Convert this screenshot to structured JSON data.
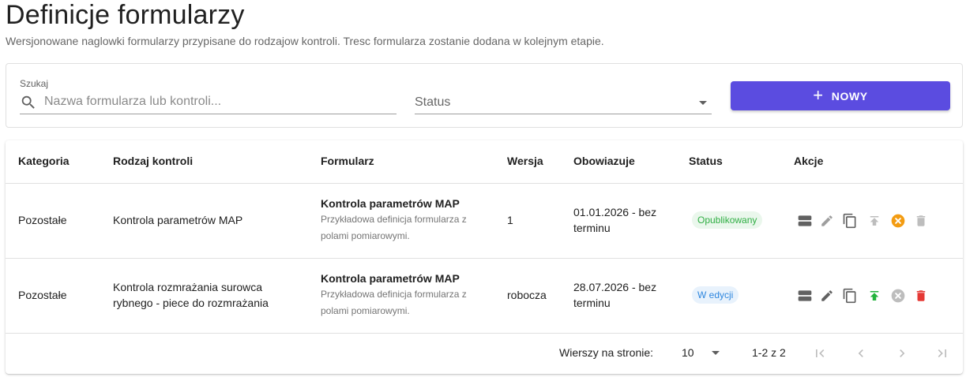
{
  "page": {
    "title": "Definicje formularzy",
    "subtitle": "Wersjonowane naglowki formularzy przypisane do rodzajow kontroli. Tresc formularza zostanie dodana w kolejnym etapie."
  },
  "filters": {
    "search_label": "Szukaj",
    "search_placeholder": "Nazwa formularza lub kontroli...",
    "search_value": "",
    "status_label": "Status",
    "new_button_label": "NOWY"
  },
  "colors": {
    "accent": "#5b4ce0",
    "published_badge": "#2fae43",
    "edit_badge": "#2e86de",
    "publish_icon_active": "#22b33c",
    "delete_icon_active": "#e53935",
    "withdraw_icon_active": "#f39c12"
  },
  "table": {
    "headers": {
      "category": "Kategoria",
      "control_type": "Rodzaj kontroli",
      "form": "Formularz",
      "version": "Wersja",
      "valid": "Obowiazuje",
      "status": "Status",
      "actions": "Akcje"
    },
    "rows": [
      {
        "category": "Pozostałe",
        "control_type_line1": "Kontrola parametrów MAP",
        "control_type_line2": "",
        "form_title": "Kontrola parametrów MAP",
        "form_desc_line1": "Przykładowa definicja formularza z",
        "form_desc_line2": "polami pomiarowymi.",
        "version": "1",
        "valid_line1": "01.01.2026 - bez",
        "valid_line2": "terminu",
        "status": "Opublikowany",
        "actions": [
          "rows-icon",
          "edit-icon",
          "copy-icon",
          "publish-icon-disabled",
          "withdraw-icon-active",
          "delete-icon-disabled"
        ]
      },
      {
        "category": "Pozostałe",
        "control_type_line1": "Kontrola rozmrażania surowca",
        "control_type_line2": "rybnego - piece do rozmrażania",
        "form_title": "Kontrola parametrów MAP",
        "form_desc_line1": "Przykładowa definicja formularza z",
        "form_desc_line2": "polami pomiarowymi.",
        "version": "robocza",
        "valid_line1": "28.07.2026 - bez",
        "valid_line2": "terminu",
        "status": "W edycji",
        "actions": [
          "rows-icon",
          "edit-icon",
          "copy-icon",
          "publish-icon-active",
          "withdraw-icon-disabled",
          "delete-icon-active"
        ]
      }
    ]
  },
  "pagination": {
    "rows_per_page_label": "Wierszy na stronie:",
    "rows_per_page_value": "10",
    "range": "1-2 z 2"
  }
}
